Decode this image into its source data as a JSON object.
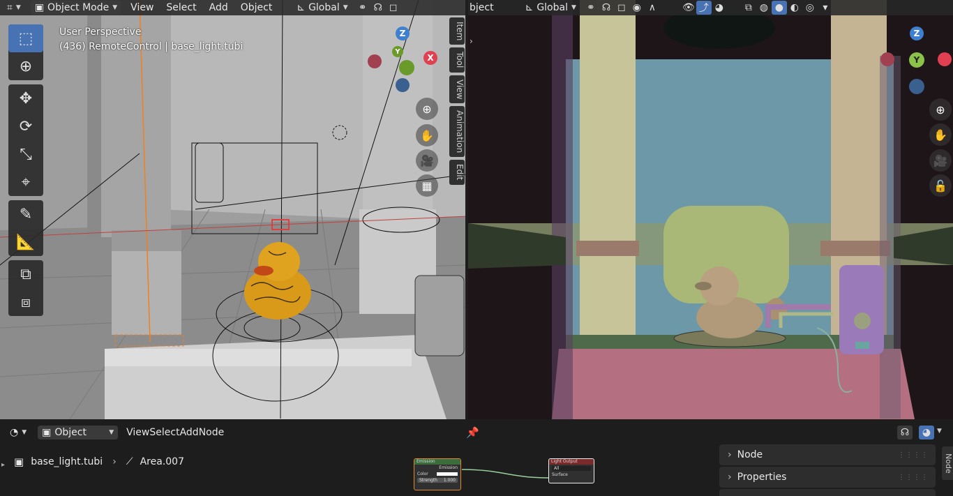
{
  "left_header": {
    "mode_label": "Object Mode",
    "menus": [
      "View",
      "Select",
      "Add",
      "Object"
    ],
    "transform_orientation": "Global"
  },
  "right_header": {
    "menu_cut": "bject",
    "transform_orientation": "Global"
  },
  "left_viewport": {
    "perspective": "User Perspective",
    "context": "(436) RemoteControl | base_light.tubi",
    "side_tabs": [
      "Item",
      "Tool",
      "View",
      "Animation",
      "Edit"
    ],
    "gizmo": {
      "z": "Z",
      "y": "Y",
      "x": "X"
    }
  },
  "right_viewport": {
    "gizmo": {
      "z": "Z",
      "y": "Y"
    }
  },
  "node_editor": {
    "editor_type": "Object",
    "menus": [
      "View",
      "Select",
      "Add",
      "Node"
    ],
    "breadcrumb": {
      "object": "base_light.tubi",
      "data": "Area.007"
    },
    "panel_rows": [
      "Node",
      "Properties"
    ],
    "side_tab": "Node",
    "emission_node": {
      "title": "Emission",
      "output": "Emission",
      "inputs": [
        "Color",
        "Strength"
      ],
      "strength": "1.000"
    },
    "output_node": {
      "title": "Light Output",
      "target": "All",
      "input": "Surface"
    }
  },
  "colors": {
    "accent": "#4772b3",
    "header_bg": "#282828",
    "x_axis": "#e0404f",
    "y_axis": "#8bc34a",
    "z_axis": "#3f7fd0",
    "emission_header": "#3c6b3c",
    "light_output_header": "#7a2a2a"
  }
}
